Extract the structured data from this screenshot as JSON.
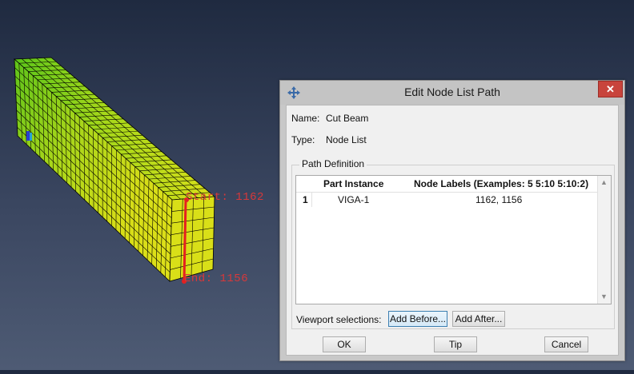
{
  "viewport": {
    "start_label": "Start: 1162",
    "end_label": "End: 1156",
    "colors": {
      "background": "#2d3850",
      "mesh_yellow": "#d9e019",
      "mesh_green": "#57c41a",
      "path_line": "#e52020"
    }
  },
  "dialog": {
    "title": "Edit Node List Path",
    "close_icon": "close-icon",
    "name_label": "Name:",
    "name_value": "Cut Beam",
    "type_label": "Type:",
    "type_value": "Node List",
    "group_title": "Path Definition",
    "table": {
      "columns": [
        "Part Instance",
        "Node Labels (Examples: 5 5:10 5:10:2)"
      ],
      "rows": [
        {
          "index": "1",
          "part_instance": "VIGA-1",
          "node_labels": "1162, 1156"
        }
      ]
    },
    "viewport_selections_label": "Viewport selections:",
    "add_before_label": "Add Before...",
    "add_after_label": "Add After...",
    "ok_label": "OK",
    "tip_label": "Tip",
    "cancel_label": "Cancel"
  }
}
